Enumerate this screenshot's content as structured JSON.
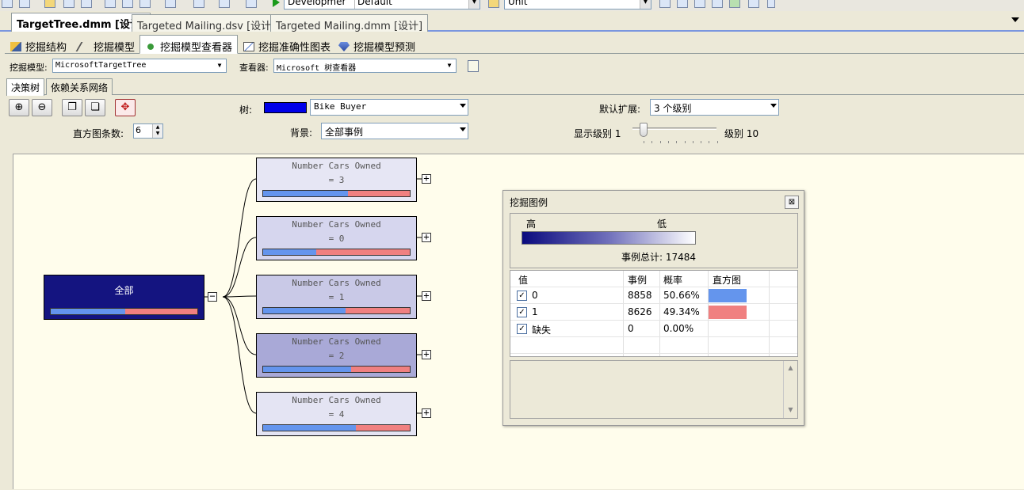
{
  "toolbar": {
    "config_combo": "Developmer",
    "platform_combo": "Default",
    "target_combo": "Unit"
  },
  "doc_tabs": [
    {
      "label": "TargetTree.dmm [设计]"
    },
    {
      "label": "Targeted Mailing.dsv [设计]"
    },
    {
      "label": "Targeted Mailing.dmm [设计]"
    }
  ],
  "sub_tabs": [
    {
      "label": "挖掘结构"
    },
    {
      "label": "挖掘模型"
    },
    {
      "label": "挖掘模型查看器"
    },
    {
      "label": "挖掘准确性图表"
    },
    {
      "label": "挖掘模型预测"
    }
  ],
  "model_bar": {
    "model_label": "挖掘模型:",
    "model_value": "MicrosoftTargetTree",
    "viewer_label": "查看器:",
    "viewer_value": "Microsoft 树查看器"
  },
  "viewer_tabs": [
    {
      "label": "决策树"
    },
    {
      "label": "依赖关系网络"
    }
  ],
  "controls": {
    "tree_label": "树:",
    "tree_value": "Bike Buyer",
    "tree_color": "#0000e8",
    "hist_label": "直方图条数:",
    "hist_value": "6",
    "background_label": "背景:",
    "background_value": "全部事例",
    "default_expand_label": "默认扩展:",
    "default_expand_value": "3 个级别",
    "show_level_label": "显示级别",
    "level_min": "1",
    "level_max_label": "级别",
    "level_max": "10",
    "slider_level": 1
  },
  "tree": {
    "root": {
      "label": "全部",
      "share_0": 0.5066
    },
    "children": [
      {
        "line1": "Number Cars Owned",
        "line2": "= 3",
        "share_0": 0.58,
        "shade": "#e6e6f4"
      },
      {
        "line1": "Number Cars Owned",
        "line2": "= 0",
        "share_0": 0.36,
        "shade": "#d6d6ee"
      },
      {
        "line1": "Number Cars Owned",
        "line2": "= 1",
        "share_0": 0.56,
        "shade": "#c9c9e7"
      },
      {
        "line1": "Number Cars Owned",
        "line2": "= 2",
        "share_0": 0.6,
        "shade": "#a9a9d7"
      },
      {
        "line1": "Number Cars Owned",
        "line2": "= 4",
        "share_0": 0.63,
        "shade": "#e4e4f3"
      }
    ],
    "colors": {
      "value_0": "#6495ed",
      "value_1": "#f08080",
      "root": "#141480",
      "root_text": "#ffffff"
    }
  },
  "legend": {
    "title": "挖掘图例",
    "high": "高",
    "low": "低",
    "total_label": "事例总计:",
    "total_value": "17484",
    "columns": [
      "值",
      "事例",
      "概率",
      "直方图"
    ],
    "rows": [
      {
        "value": "0",
        "cases": "8858",
        "prob": "50.66%",
        "color": "#6495ed"
      },
      {
        "value": "1",
        "cases": "8626",
        "prob": "49.34%",
        "color": "#f08080"
      },
      {
        "value": "缺失",
        "cases": "0",
        "prob": "0.00%",
        "color": ""
      }
    ]
  }
}
